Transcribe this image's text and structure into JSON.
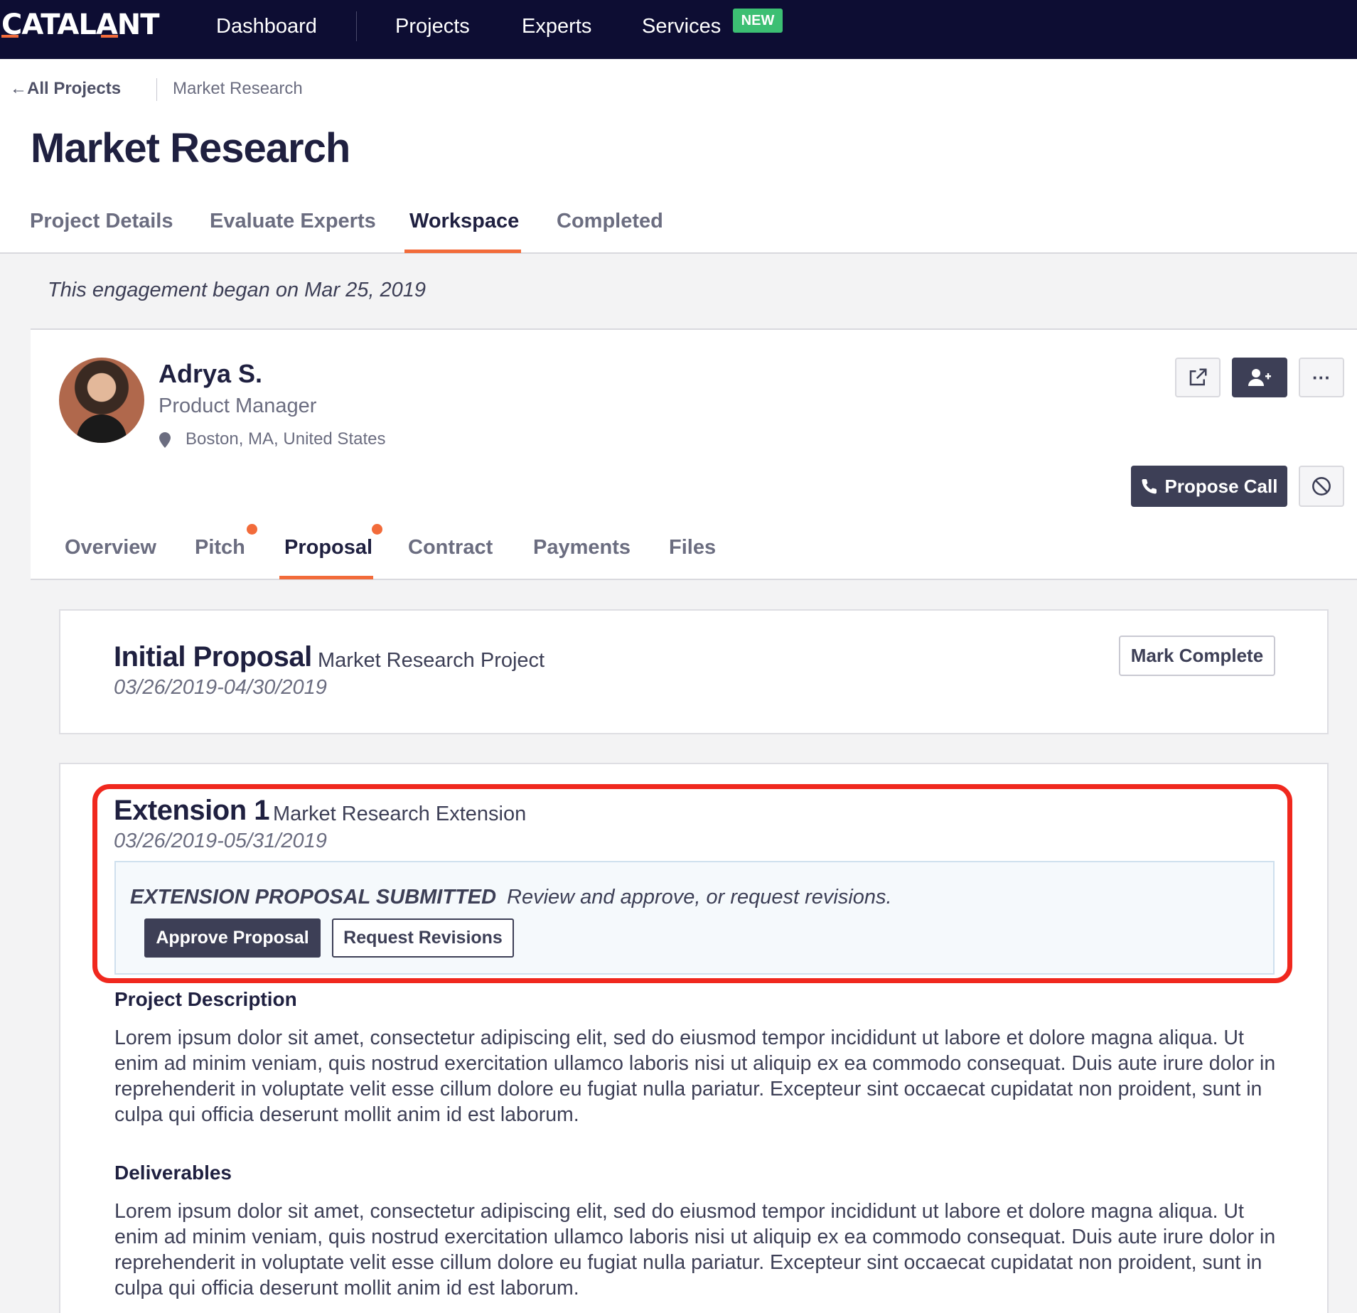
{
  "nav": {
    "logo": "CATALANT",
    "links": [
      "Dashboard",
      "Projects",
      "Experts",
      "Services"
    ],
    "new_badge": "NEW"
  },
  "breadcrumb": {
    "back": "All Projects",
    "current": "Market Research"
  },
  "page_title": "Market Research",
  "main_tabs": [
    "Project Details",
    "Evaluate Experts",
    "Workspace",
    "Completed"
  ],
  "main_tab_active": "Workspace",
  "engagement_note": "This engagement began on Mar 25, 2019",
  "expert": {
    "name": "Adrya S.",
    "role": "Product Manager",
    "location": "Boston, MA, United States",
    "propose_call": "Propose Call"
  },
  "sub_tabs": [
    "Overview",
    "Pitch",
    "Proposal",
    "Contract",
    "Payments",
    "Files"
  ],
  "sub_tab_active": "Proposal",
  "initial": {
    "title": "Initial Proposal",
    "subtitle": "Market Research Project",
    "dates": "03/26/2019-04/30/2019",
    "mark_complete": "Mark Complete"
  },
  "extension": {
    "title": "Extension 1",
    "subtitle": "Market Research Extension",
    "dates": "03/26/2019-05/31/2019",
    "status": "EXTENSION PROPOSAL SUBMITTED",
    "status_msg": "Review and approve, or request revisions.",
    "approve": "Approve Proposal",
    "revise": "Request Revisions"
  },
  "description": {
    "heading": "Project Description",
    "body": "Lorem ipsum dolor sit amet, consectetur adipiscing elit, sed do eiusmod tempor incididunt ut labore et dolore magna aliqua. Ut enim ad minim veniam, quis nostrud exercitation ullamco laboris nisi ut aliquip ex ea commodo consequat. Duis aute irure dolor in reprehenderit in voluptate velit esse cillum dolore eu fugiat nulla pariatur. Excepteur sint occaecat cupidatat non proident, sunt in culpa qui officia deserunt mollit anim id est laborum."
  },
  "deliverables": {
    "heading": "Deliverables",
    "body": "Lorem ipsum dolor sit amet, consectetur adipiscing elit, sed do eiusmod tempor incididunt ut labore et dolore magna aliqua. Ut enim ad minim veniam, quis nostrud exercitation ullamco laboris nisi ut aliquip ex ea commodo consequat. Duis aute irure dolor in reprehenderit in voluptate velit esse cillum dolore eu fugiat nulla pariatur. Excepteur sint occaecat cupidatat non proident, sunt in culpa qui officia deserunt mollit anim id est laborum."
  },
  "colors": {
    "nav_bg": "#0d0d33",
    "accent": "#f26b3a",
    "primary_btn": "#3d3f56",
    "highlight": "#f0281e",
    "badge": "#3cbf73"
  }
}
